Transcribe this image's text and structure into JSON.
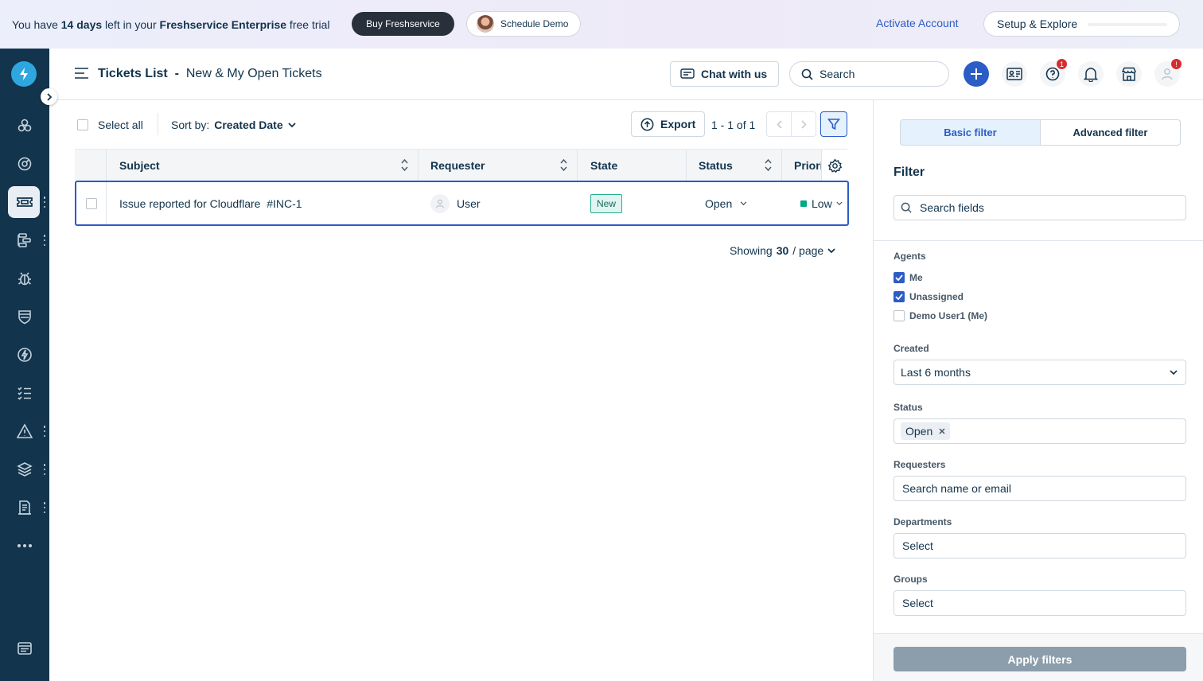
{
  "banner": {
    "trial_prefix": "You have ",
    "trial_days": "14 days",
    "trial_mid": " left in your ",
    "trial_product": "Freshservice Enterprise",
    "trial_suffix": " free trial",
    "buy_label": "Buy Freshservice",
    "demo_label": "Schedule Demo",
    "activate_label": "Activate Account",
    "setup_label": "Setup & Explore"
  },
  "sidebar": {
    "items": [
      {
        "icon": "dashboard-icon"
      },
      {
        "icon": "speedometer-icon"
      },
      {
        "icon": "ticket-icon",
        "active": true
      },
      {
        "icon": "workflow-icon"
      },
      {
        "icon": "bug-icon"
      },
      {
        "icon": "shield-icon"
      },
      {
        "icon": "lightning-icon"
      },
      {
        "icon": "checklist-icon"
      },
      {
        "icon": "alert-icon"
      },
      {
        "icon": "layers-icon"
      },
      {
        "icon": "document-icon"
      },
      {
        "icon": "more-icon"
      }
    ]
  },
  "header": {
    "title": "Tickets List",
    "separator": "-",
    "view": "New & My Open Tickets",
    "chat_label": "Chat with us",
    "search_placeholder": "Search",
    "help_badge": "1",
    "profile_badge": "!"
  },
  "toolbar": {
    "select_all": "Select all",
    "sort_prefix": "Sort by: ",
    "sort_value": "Created Date",
    "export_label": "Export",
    "page_info": "1 - 1 of 1"
  },
  "table": {
    "columns": [
      "Subject",
      "Requester",
      "State",
      "Status",
      "Priori"
    ],
    "rows": [
      {
        "subject": "Issue reported for Cloudflare",
        "id": "#INC-1",
        "requester": "User",
        "state": "New",
        "status": "Open",
        "priority": "Low"
      }
    ]
  },
  "pagination": {
    "showing_prefix": "Showing",
    "per_page": "30",
    "suffix": "/ page"
  },
  "filter_panel": {
    "tab_basic": "Basic filter",
    "tab_advanced": "Advanced filter",
    "title": "Filter",
    "search_placeholder": "Search fields",
    "agents_label": "Agents",
    "agents": [
      {
        "label": "Me",
        "checked": true
      },
      {
        "label": "Unassigned",
        "checked": true
      },
      {
        "label": "Demo User1 (Me)",
        "checked": false
      }
    ],
    "created_label": "Created",
    "created_value": "Last 6 months",
    "status_label": "Status",
    "status_tag": "Open",
    "requesters_label": "Requesters",
    "requesters_placeholder": "Search name or email",
    "departments_label": "Departments",
    "departments_value": "Select",
    "groups_label": "Groups",
    "groups_value": "Select",
    "apply_label": "Apply filters"
  },
  "colors": {
    "sidebar": "#12344d",
    "primary": "#2c5cc5",
    "badge": "#d72d30",
    "priority_low": "#00a886"
  }
}
